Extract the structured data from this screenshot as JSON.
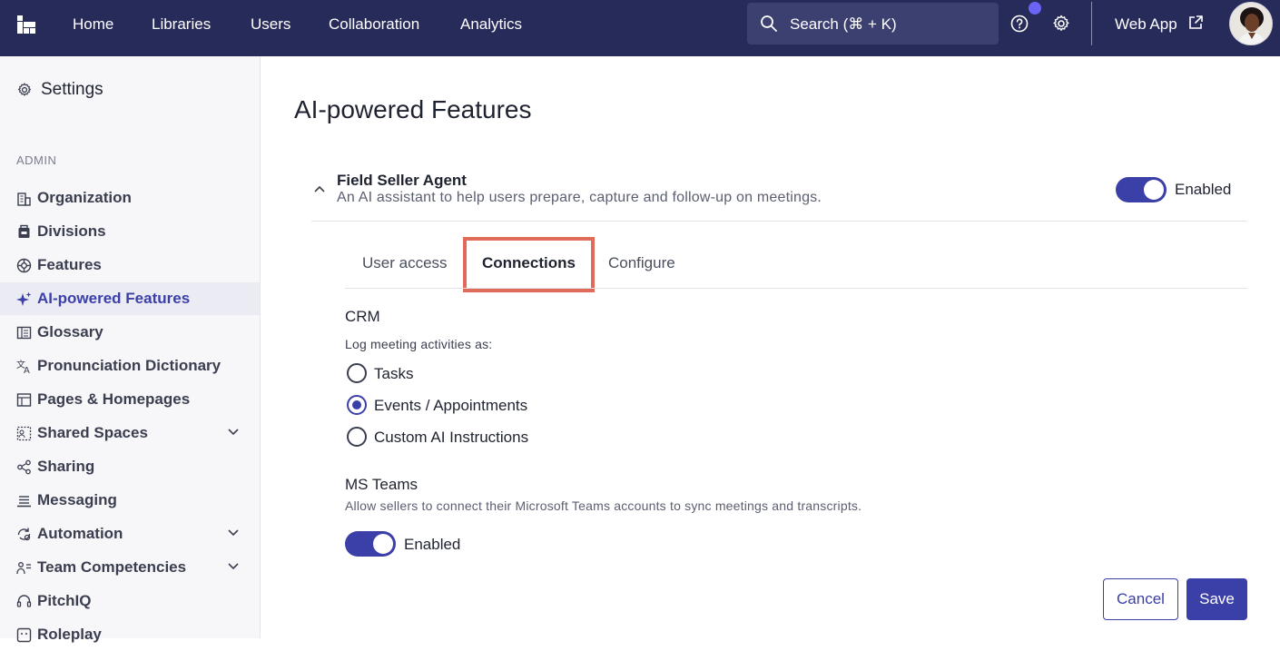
{
  "topnav": {
    "links": [
      "Home",
      "Libraries",
      "Users",
      "Collaboration",
      "Analytics"
    ],
    "search_label": "Search (⌘ + K)",
    "web_app_label": "Web App"
  },
  "sidebar": {
    "title": "Settings",
    "section": "ADMIN",
    "items": [
      {
        "label": "Organization",
        "icon": "building-icon"
      },
      {
        "label": "Divisions",
        "icon": "divisions-icon"
      },
      {
        "label": "Features",
        "icon": "features-icon"
      },
      {
        "label": "AI-powered Features",
        "icon": "sparkle-icon",
        "active": true
      },
      {
        "label": "Glossary",
        "icon": "glossary-icon"
      },
      {
        "label": "Pronunciation Dictionary",
        "icon": "translate-icon"
      },
      {
        "label": "Pages & Homepages",
        "icon": "pages-icon"
      },
      {
        "label": "Shared Spaces",
        "icon": "shared-spaces-icon",
        "expandable": true
      },
      {
        "label": "Sharing",
        "icon": "share-icon"
      },
      {
        "label": "Messaging",
        "icon": "messaging-icon"
      },
      {
        "label": "Automation",
        "icon": "automation-icon",
        "expandable": true
      },
      {
        "label": "Team Competencies",
        "icon": "team-icon",
        "expandable": true
      },
      {
        "label": "PitchIQ",
        "icon": "headset-icon"
      },
      {
        "label": "Roleplay",
        "icon": "roleplay-icon"
      }
    ]
  },
  "main": {
    "title": "AI-powered Features",
    "agent": {
      "name": "Field Seller Agent",
      "description": "An AI assistant to help users prepare, capture and follow-up on meetings.",
      "toggle_label": "Enabled",
      "enabled": true
    },
    "tabs": [
      "User access",
      "Connections",
      "Configure"
    ],
    "active_tab": "Connections",
    "crm": {
      "title": "CRM",
      "prompt": "Log meeting activities as:",
      "options": [
        "Tasks",
        "Events / Appointments",
        "Custom AI Instructions"
      ],
      "selected": "Events / Appointments"
    },
    "ms_teams": {
      "title": "MS Teams",
      "description": "Allow sellers to connect their Microsoft Teams accounts to sync meetings and transcripts.",
      "toggle_label": "Enabled",
      "enabled": true
    },
    "buttons": {
      "cancel": "Cancel",
      "save": "Save"
    }
  },
  "colors": {
    "nav_bg": "#262b5a",
    "accent": "#3b3fa8",
    "highlight": "#e06b58"
  }
}
